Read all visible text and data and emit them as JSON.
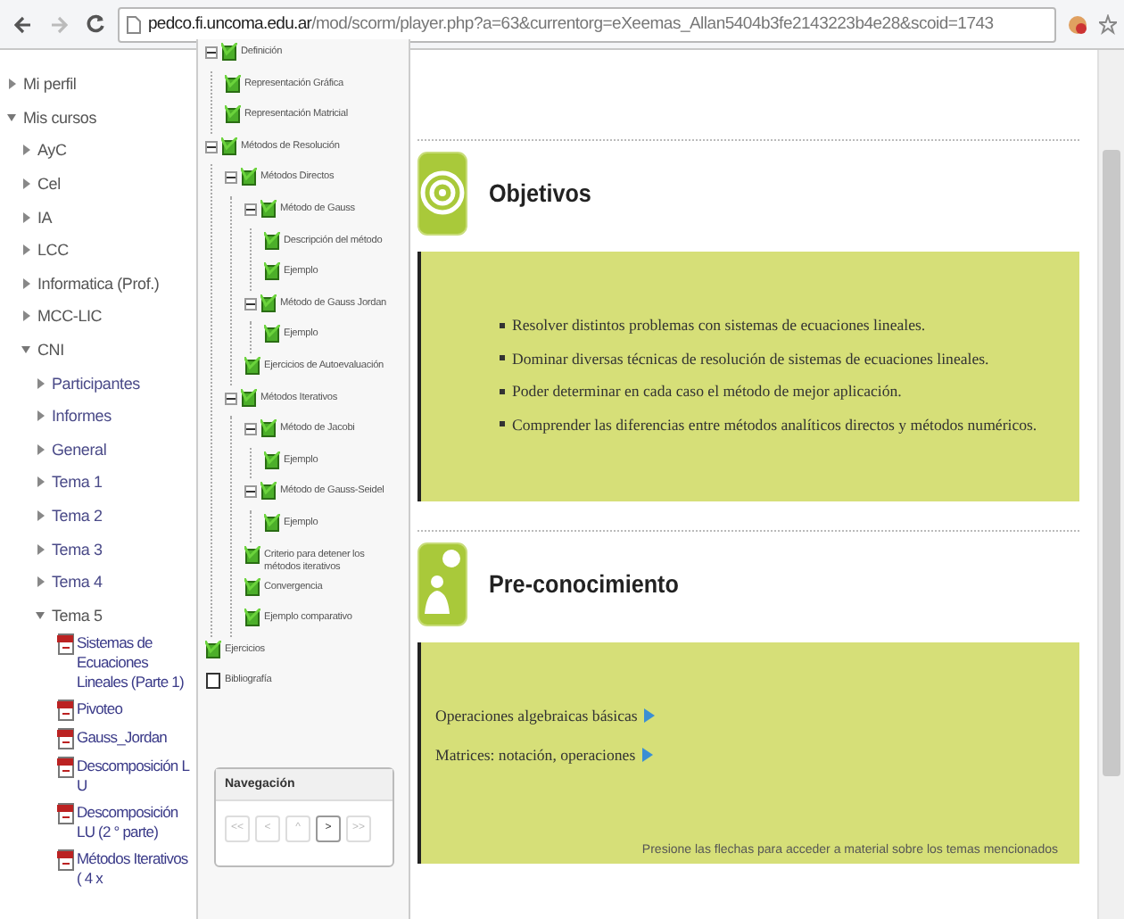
{
  "address_bar": {
    "host": "pedco.fi.uncoma.edu.ar",
    "path": "/mod/scorm/player.php?a=63&currentorg=eXeemas_Allan5404b3fe2143223b4e28&scoid=1743"
  },
  "nav": [
    {
      "label": "Mi perfil",
      "kind": "node",
      "expanded": false
    },
    {
      "label": "Mis cursos",
      "kind": "node",
      "expanded": true,
      "children": [
        {
          "label": "AyC",
          "kind": "node",
          "expanded": false
        },
        {
          "label": "Cel",
          "kind": "node",
          "expanded": false
        },
        {
          "label": "IA",
          "kind": "node",
          "expanded": false
        },
        {
          "label": "LCC",
          "kind": "node",
          "expanded": false
        },
        {
          "label": "Informatica (Prof.)",
          "kind": "node",
          "expanded": false
        },
        {
          "label": "MCC-LIC",
          "kind": "node",
          "expanded": false
        },
        {
          "label": "CNI",
          "kind": "node",
          "expanded": true,
          "children": [
            {
              "label": "Participantes",
              "kind": "node",
              "expanded": false
            },
            {
              "label": "Informes",
              "kind": "node",
              "expanded": false
            },
            {
              "label": "General",
              "kind": "node",
              "expanded": false
            },
            {
              "label": "Tema 1",
              "kind": "node",
              "expanded": false
            },
            {
              "label": "Tema 2",
              "kind": "node",
              "expanded": false
            },
            {
              "label": "Tema 3",
              "kind": "node",
              "expanded": false
            },
            {
              "label": "Tema 4",
              "kind": "node",
              "expanded": false
            },
            {
              "label": "Tema 5",
              "kind": "node",
              "expanded": true,
              "children": [
                {
                  "label": "Sistemas de Ecuaciones Lineales (Parte 1)",
                  "kind": "file"
                },
                {
                  "label": "Pivoteo",
                  "kind": "file"
                },
                {
                  "label": "Gauss_Jordan",
                  "kind": "file"
                },
                {
                  "label": "Descomposición L U",
                  "kind": "file"
                },
                {
                  "label": "Descomposición LU (2 ° parte)",
                  "kind": "file"
                },
                {
                  "label": "Métodos Iterativos ( 4 x",
                  "kind": "file"
                }
              ]
            }
          ]
        }
      ]
    }
  ],
  "toc": [
    {
      "label": "Definición",
      "completed": true,
      "expanded": true,
      "children": [
        {
          "label": "Representación Gráfica",
          "completed": true
        },
        {
          "label": "Representación Matricial",
          "completed": true
        }
      ]
    },
    {
      "label": "Métodos de Resolución",
      "completed": true,
      "expanded": true,
      "children": [
        {
          "label": "Métodos Directos",
          "completed": true,
          "expanded": true,
          "children": [
            {
              "label": "Método de Gauss",
              "completed": true,
              "expanded": true,
              "children": [
                {
                  "label": "Descripción del método",
                  "completed": true
                },
                {
                  "label": "Ejemplo",
                  "completed": true
                }
              ]
            },
            {
              "label": "Método de Gauss Jordan",
              "completed": true,
              "expanded": true,
              "children": [
                {
                  "label": "Ejemplo",
                  "completed": true
                }
              ]
            },
            {
              "label": "Ejercicios de Autoevaluación",
              "completed": true
            }
          ]
        },
        {
          "label": "Métodos Iterativos",
          "completed": true,
          "expanded": true,
          "children": [
            {
              "label": "Método de Jacobi",
              "completed": true,
              "expanded": true,
              "children": [
                {
                  "label": "Ejemplo",
                  "completed": true
                }
              ]
            },
            {
              "label": "Método de Gauss-Seidel",
              "completed": true,
              "expanded": true,
              "children": [
                {
                  "label": "Ejemplo",
                  "completed": true
                }
              ]
            },
            {
              "label": "Criterio para detener los métodos iterativos",
              "completed": true
            },
            {
              "label": "Convergencia",
              "completed": true
            },
            {
              "label": "Ejemplo comparativo",
              "completed": true
            }
          ]
        }
      ]
    },
    {
      "label": "Ejercicios",
      "completed": true
    },
    {
      "label": "Bibliografía",
      "completed": false
    }
  ],
  "navigation": {
    "title": "Navegación",
    "buttons": [
      {
        "label": "<<",
        "disabled": true
      },
      {
        "label": "<",
        "disabled": true
      },
      {
        "label": "^",
        "disabled": true
      },
      {
        "label": ">",
        "disabled": false
      },
      {
        "label": ">>",
        "disabled": true
      }
    ]
  },
  "sections": [
    {
      "kind": "objectives",
      "title": "Objetivos",
      "bullets": [
        "Resolver distintos problemas con sistemas de ecuaciones lineales.",
        "Dominar diversas técnicas de resolución de sistemas de ecuaciones lineales.",
        "Poder determinar en cada caso el método de mejor aplicación.",
        "Comprender las diferencias entre métodos analíticos directos y métodos numéricos."
      ]
    },
    {
      "kind": "prior",
      "title": "Pre-conocimiento",
      "links": [
        "Operaciones algebraicas básicas",
        "Matrices: notación, operaciones"
      ],
      "note": "Presione las flechas para acceder a material sobre los temas mencionados"
    }
  ]
}
